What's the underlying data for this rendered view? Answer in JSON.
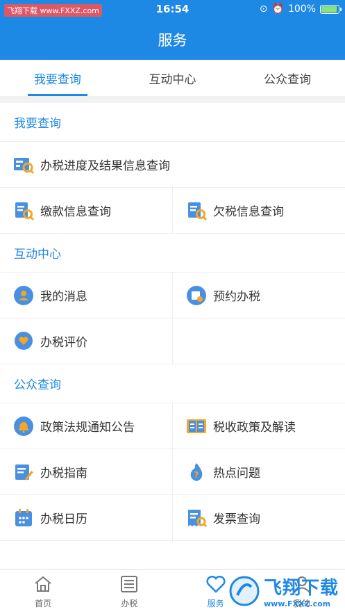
{
  "status": {
    "watermark": "飞翔下载 www.FXXZ.com",
    "time": "16:54",
    "battery": "100%"
  },
  "header": {
    "title": "服务"
  },
  "tabs": [
    {
      "label": "我要查询",
      "active": true
    },
    {
      "label": "互动中心",
      "active": false
    },
    {
      "label": "公众查询",
      "active": false
    }
  ],
  "sections": {
    "query": {
      "title": "我要查询",
      "items": [
        "办税进度及结果信息查询",
        "缴款信息查询",
        "欠税信息查询"
      ]
    },
    "interact": {
      "title": "互动中心",
      "items": [
        "我的消息",
        "预约办税",
        "办税评价"
      ]
    },
    "public": {
      "title": "公众查询",
      "items": [
        "政策法规通知公告",
        "税收政策及解读",
        "办税指南",
        "热点问题",
        "办税日历",
        "发票查询"
      ]
    }
  },
  "tabbar": [
    {
      "label": "首页",
      "icon": "home-icon"
    },
    {
      "label": "办税",
      "icon": "list-icon"
    },
    {
      "label": "服务",
      "icon": "heart-icon",
      "active": true
    },
    {
      "label": "我的",
      "icon": "user-icon"
    }
  ],
  "brand": {
    "name": "飞翔下载",
    "url": "www.FXXZ.com"
  },
  "colors": {
    "primary": "#1e88e5",
    "icon_orange": "#f5a623",
    "icon_blue": "#4a90e2"
  }
}
